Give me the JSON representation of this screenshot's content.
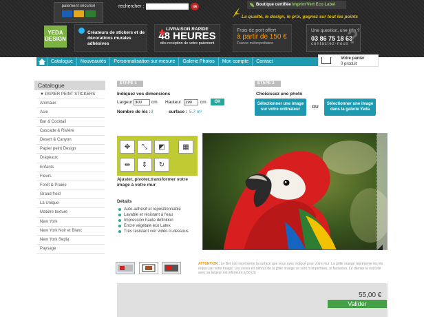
{
  "header": {
    "payment_label": "paiement sécurisé",
    "search_label": "rechercher :",
    "search_value": "",
    "search_ok": "ok",
    "eco_prefix": "Boutique certifiée",
    "eco_label": "Imprim'Vert Eco Label",
    "tagline": "La qualité, le design, le prix, gagnez sur tout les points",
    "logo": "YEDA DESIGN",
    "creators": "Créateurs de stickers et de décorations murales adhésives",
    "delivery_l1": "LIVRAISON RAPIDE",
    "delivery_l2": "48 HEURES",
    "delivery_l3": "dès reception de votre paiement",
    "shipping_l1": "Frais de port offert",
    "shipping_l2": "à partir de 150 €",
    "shipping_l3": "France métropolitaine",
    "contact_q": "Une question, une info ?",
    "contact_phone": "03 86 75 18 63",
    "contact_link": "contactez-nous"
  },
  "nav": {
    "items": [
      "Catalogue",
      "Nouveautés",
      "Personnalisation sur-mesure",
      "Galerie Photos",
      "Mon compte",
      "Contact"
    ]
  },
  "basket": {
    "title": "Votre panier",
    "count": "0 produit"
  },
  "sidebar": {
    "heading": "Catalogue",
    "items": [
      "▼ PAPIER PEINT STICKERS",
      "Animaux",
      "Asie",
      "Bar & Cocktail",
      "Cascade & Rivière",
      "Desert & Canyon",
      "Papier peint Design",
      "Drapeaux",
      "Enfants",
      "Fleurs",
      "Forêt & Prairie",
      "Grand froid",
      "La Unique",
      "Matière texture",
      "New York",
      "New York Noir et Blanc",
      "New York Sepia",
      "Paysage"
    ]
  },
  "step1": {
    "badge": "ETAPE 1",
    "title": "Indiquez vos dimensions",
    "width_label": "Largeur",
    "width_value": "300",
    "height_label": "Hauteur",
    "height_value": "190",
    "unit": "cm",
    "ok": "OK",
    "strips_label": "Nombre de lés :",
    "strips_value": "3",
    "surface_label": "surface :",
    "surface_value": "5.7 m²"
  },
  "step2": {
    "badge": "ETAPE 2",
    "title": "Choisissez une photo",
    "btn_computer": "Sélectionner une image sur votre ordinateur",
    "or": "OU",
    "btn_gallery": "Sélectionner une image dans la galerie Yeda"
  },
  "editor": {
    "hint": "Ajuster, pivoter,transformer votre image à votre mur",
    "details_title": "Détails",
    "features": [
      "Auto-adhésif et repositionnable",
      "Lavable et résistant à l'eau",
      "Impression haute définition",
      "Encre végétale éco Latex",
      "Très resistant voir vidéo ci-dessous"
    ]
  },
  "note": {
    "prefix": "ATTENTION :",
    "text": "Le filet noir représente la surface que vous avez indiqué pour votre mur. La grille orange représente les lés requis par votre image. Les zones en dehors de la grille orange ne sont ni imprimées, ni facturées. Le dernier lé est livré avec sa largeur est inférieure à 50 cm"
  },
  "order": {
    "price": "55,00 €",
    "validate": "Valider"
  },
  "colors": {
    "accent": "#1e9ab0",
    "green": "#43a047",
    "olive": "#c0ca33",
    "orange": "#ff8f00"
  }
}
